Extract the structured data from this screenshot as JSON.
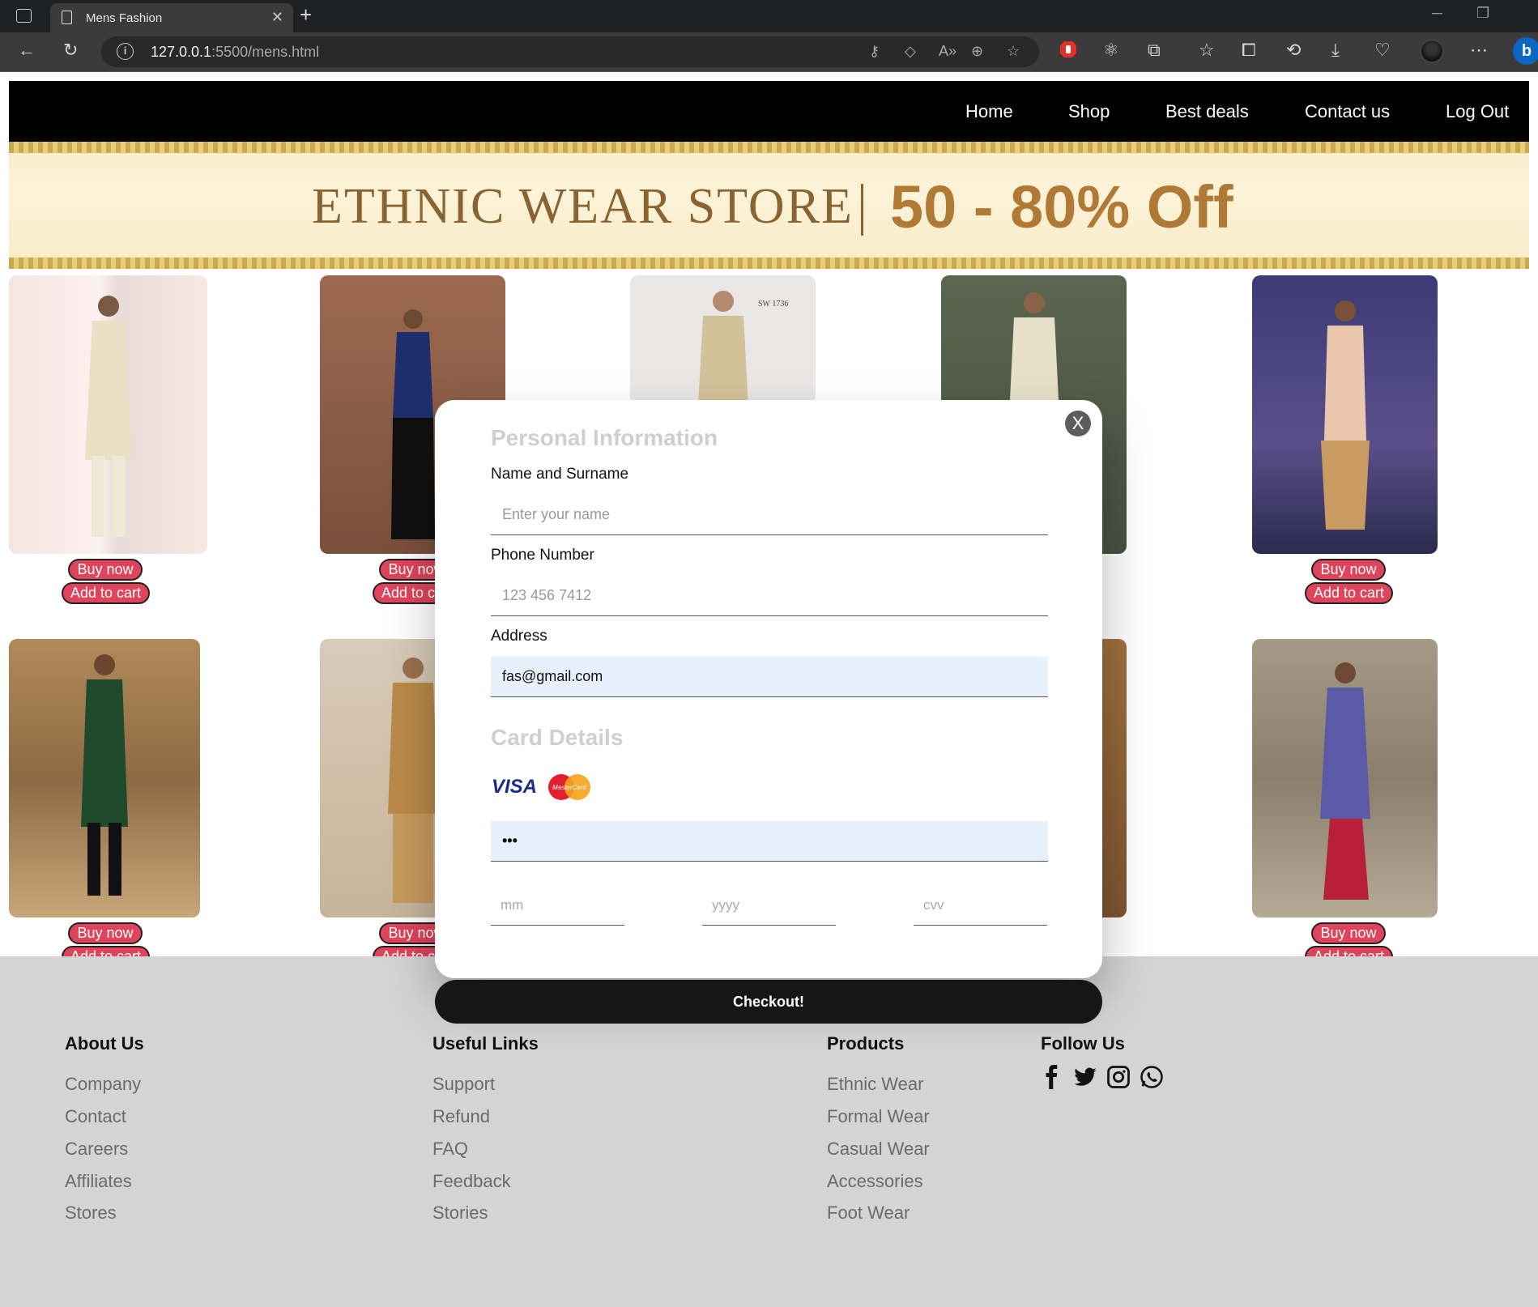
{
  "browser": {
    "tab_title": "Mens Fashion",
    "url_host": "127.0.0.1",
    "url_rest": ":5500/mens.html"
  },
  "navbar": {
    "links": [
      "Home",
      "Shop",
      "Best deals",
      "Contact us",
      "Log Out"
    ]
  },
  "banner": {
    "text_left": "ETHNIC WEAR STORE",
    "text_right": "50 - 80% Off"
  },
  "products": {
    "buy_label": "Buy now",
    "cart_label": "Add to cart",
    "image_caption": "SW 1736"
  },
  "modal": {
    "close_label": "X",
    "personal_title": "Personal Information",
    "name_label": "Name and Surname",
    "name_placeholder": "Enter your name",
    "phone_label": "Phone Number",
    "phone_placeholder": "123 456 7412",
    "address_label": "Address",
    "address_value": "fas@gmail.com",
    "card_title": "Card Details",
    "card_brand_visa": "VISA",
    "card_brand_mc": "MasterCard",
    "card_number_value": "•••",
    "mm_placeholder": "mm",
    "yyyy_placeholder": "yyyy",
    "cvv_placeholder": "cvv",
    "checkout_label": "Checkout!"
  },
  "footer": {
    "about": {
      "title": "About Us",
      "links": [
        "Company",
        "Contact",
        "Careers",
        "Affiliates",
        "Stores"
      ]
    },
    "useful": {
      "title": "Useful Links",
      "links": [
        "Support",
        "Refund",
        "FAQ",
        "Feedback",
        "Stories"
      ]
    },
    "products": {
      "title": "Products",
      "links": [
        "Ethnic Wear",
        "Formal Wear",
        "Casual Wear",
        "Accessories",
        "Foot Wear"
      ]
    },
    "follow": {
      "title": "Follow Us"
    }
  },
  "colors": {
    "nav_bg": "#000000",
    "pill_bg": "#e0445a",
    "footer_bg": "#d4d4d4",
    "checkout_bg": "#161616",
    "autofill_bg": "#e8f0fe"
  },
  "icons": [
    "sidebar-toggle-icon",
    "document-icon",
    "close-icon",
    "new-tab-icon",
    "back-icon",
    "reload-icon",
    "info-icon",
    "key-icon",
    "tag-icon",
    "read-aloud-icon",
    "zoom-icon",
    "favorite-add-icon",
    "extension-icon",
    "favorites-icon",
    "collections-icon",
    "history-icon",
    "download-icon",
    "browser-essentials-icon",
    "more-icon",
    "bing-icon",
    "facebook-icon",
    "twitter-icon",
    "instagram-icon",
    "whatsapp-icon"
  ]
}
